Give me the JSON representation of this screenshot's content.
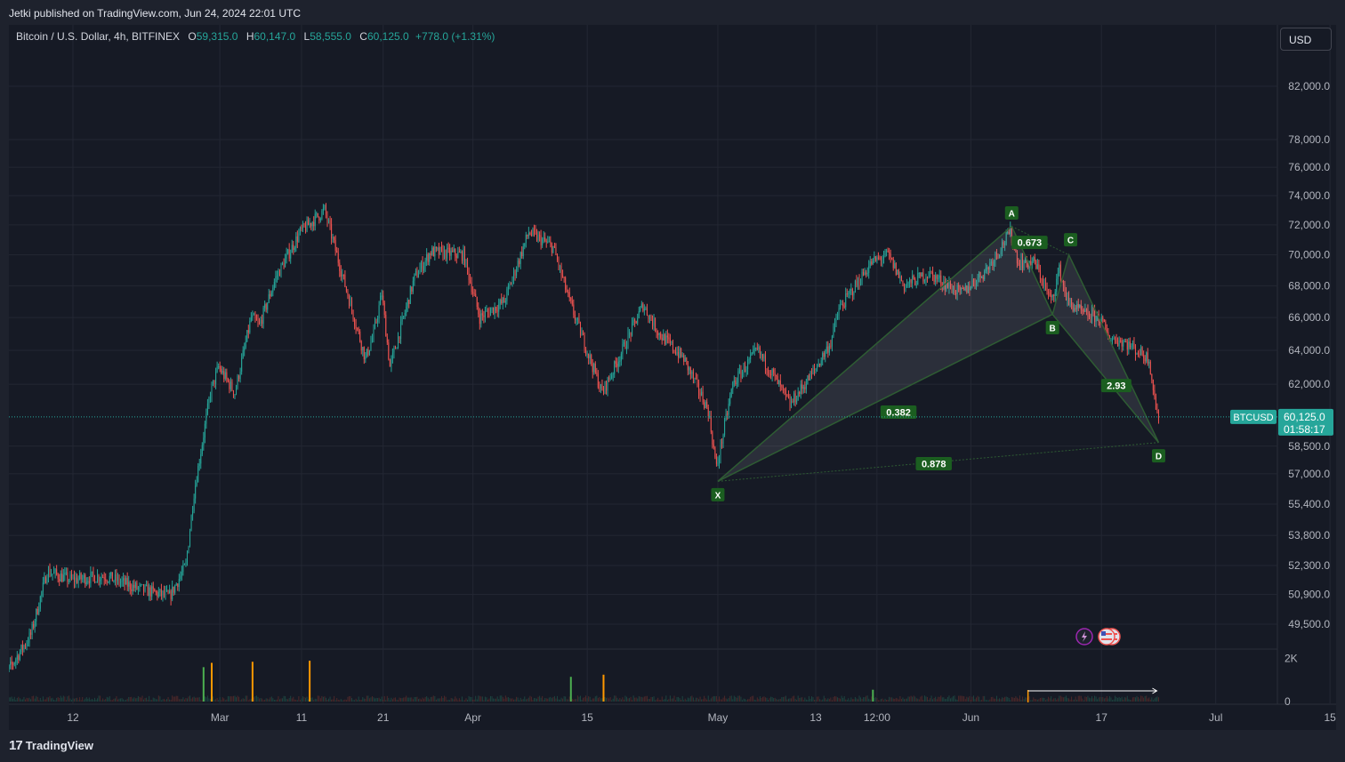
{
  "header": {
    "published": "Jetki published on TradingView.com, Jun 24, 2024 22:01 UTC"
  },
  "legend": {
    "symbol": "Bitcoin / U.S. Dollar, 4h, BITFINEX",
    "open_label": "O",
    "open": "59,315.0",
    "high_label": "H",
    "high": "60,147.0",
    "low_label": "L",
    "low": "58,555.0",
    "close_label": "C",
    "close": "60,125.0",
    "change": "+778.0 (+1.31%)"
  },
  "currency_button": "USD",
  "footer": {
    "logo_mark": "17",
    "logo_text": "TradingView"
  },
  "colors": {
    "up": "#26a69a",
    "down": "#ef5350",
    "pattern_line": "#2e5c33",
    "pattern_fill": "#b0b4bd",
    "label_bg": "#1b5e20",
    "price_tag": "#26a69a",
    "volume_up": "#4caf50",
    "volume_spike": "#ff9800"
  },
  "chart_data": {
    "type": "candlestick",
    "title": "Bitcoin / U.S. Dollar, 4h, BITFINEX",
    "y_scale": "log",
    "y_ticks": [
      "82,000.0",
      "78,000.0",
      "76,000.0",
      "74,000.0",
      "72,000.0",
      "70,000.0",
      "68,000.0",
      "66,000.0",
      "64,000.0",
      "62,000.0",
      "58,500.0",
      "57,000.0",
      "55,400.0",
      "53,800.0",
      "52,300.0",
      "50,900.0",
      "49,500.0"
    ],
    "x_ticks": [
      "12",
      "Mar",
      "11",
      "21",
      "Apr",
      "15",
      "May",
      "13",
      "12:00",
      "Jun",
      "17",
      "Jul",
      "15"
    ],
    "last_price": {
      "symbol": "BTCUSD",
      "value": "60,125.0",
      "countdown": "01:58:17",
      "price": 60125
    },
    "volume_ticks": [
      "2K",
      "0"
    ],
    "price_path": [
      {
        "x": "2024-02-03",
        "y": 46700
      },
      {
        "x": "2024-02-07",
        "y": 49000
      },
      {
        "x": "2024-02-09",
        "y": 52000
      },
      {
        "x": "2024-02-12",
        "y": 51600
      },
      {
        "x": "2024-02-16",
        "y": 51800
      },
      {
        "x": "2024-02-20",
        "y": 51200
      },
      {
        "x": "2024-02-24",
        "y": 50800
      },
      {
        "x": "2024-02-26",
        "y": 52300
      },
      {
        "x": "2024-02-27",
        "y": 56000
      },
      {
        "x": "2024-02-29",
        "y": 61500
      },
      {
        "x": "2024-03-01",
        "y": 63000
      },
      {
        "x": "2024-03-03",
        "y": 61500
      },
      {
        "x": "2024-03-05",
        "y": 66000
      },
      {
        "x": "2024-03-06",
        "y": 65500
      },
      {
        "x": "2024-03-08",
        "y": 68500
      },
      {
        "x": "2024-03-11",
        "y": 71500
      },
      {
        "x": "2024-03-14",
        "y": 73000
      },
      {
        "x": "2024-03-16",
        "y": 69000
      },
      {
        "x": "2024-03-19",
        "y": 63500
      },
      {
        "x": "2024-03-20",
        "y": 65000
      },
      {
        "x": "2024-03-21",
        "y": 67500
      },
      {
        "x": "2024-03-22",
        "y": 63000
      },
      {
        "x": "2024-03-25",
        "y": 68500
      },
      {
        "x": "2024-03-27",
        "y": 70200
      },
      {
        "x": "2024-03-31",
        "y": 70000
      },
      {
        "x": "2024-04-02",
        "y": 66000
      },
      {
        "x": "2024-04-05",
        "y": 67000
      },
      {
        "x": "2024-04-08",
        "y": 71500
      },
      {
        "x": "2024-04-11",
        "y": 70500
      },
      {
        "x": "2024-04-13",
        "y": 67000
      },
      {
        "x": "2024-04-17",
        "y": 61500
      },
      {
        "x": "2024-04-19",
        "y": 63500
      },
      {
        "x": "2024-04-22",
        "y": 66800
      },
      {
        "x": "2024-04-24",
        "y": 65000
      },
      {
        "x": "2024-04-27",
        "y": 63500
      },
      {
        "x": "2024-04-30",
        "y": 60500
      },
      {
        "x": "2024-05-01",
        "y": 57300
      },
      {
        "x": "2024-05-03",
        "y": 62000
      },
      {
        "x": "2024-05-06",
        "y": 64000
      },
      {
        "x": "2024-05-08",
        "y": 62500
      },
      {
        "x": "2024-05-10",
        "y": 60800
      },
      {
        "x": "2024-05-13",
        "y": 62800
      },
      {
        "x": "2024-05-15",
        "y": 64500
      },
      {
        "x": "2024-05-16",
        "y": 66500
      },
      {
        "x": "2024-05-20",
        "y": 69500
      },
      {
        "x": "2024-05-22",
        "y": 70000
      },
      {
        "x": "2024-05-24",
        "y": 68000
      },
      {
        "x": "2024-05-27",
        "y": 68800
      },
      {
        "x": "2024-05-31",
        "y": 67500
      },
      {
        "x": "2024-06-03",
        "y": 69000
      },
      {
        "x": "2024-06-06",
        "y": 71500
      },
      {
        "x": "2024-06-07",
        "y": 69500
      },
      {
        "x": "2024-06-09",
        "y": 69500
      },
      {
        "x": "2024-06-11",
        "y": 67000
      },
      {
        "x": "2024-06-12",
        "y": 69000
      },
      {
        "x": "2024-06-13",
        "y": 67000
      },
      {
        "x": "2024-06-15",
        "y": 66200
      },
      {
        "x": "2024-06-17",
        "y": 66000
      },
      {
        "x": "2024-06-18",
        "y": 64800
      },
      {
        "x": "2024-06-20",
        "y": 64500
      },
      {
        "x": "2024-06-23",
        "y": 63500
      },
      {
        "x": "2024-06-24",
        "y": 60125
      }
    ],
    "harmonic_pattern": {
      "points": [
        {
          "label": "X",
          "x": "2024-05-01",
          "y": 56600
        },
        {
          "label": "A",
          "x": "2024-06-06",
          "y": 71900
        },
        {
          "label": "B",
          "x": "2024-06-11",
          "y": 66200
        },
        {
          "label": "C",
          "x": "2024-06-13",
          "y": 70000
        },
        {
          "label": "D",
          "x": "2024-06-24",
          "y": 58700
        }
      ],
      "ratios": [
        {
          "label": "0.382"
        },
        {
          "label": "0.673"
        },
        {
          "label": "2.93"
        },
        {
          "label": "0.878"
        }
      ]
    },
    "volume_spikes": [
      {
        "x": "2024-02-28",
        "value": 1600,
        "color": "green"
      },
      {
        "x": "2024-02-29",
        "value": 1800,
        "color": "orange"
      },
      {
        "x": "2024-03-05",
        "value": 1850,
        "color": "orange"
      },
      {
        "x": "2024-03-12",
        "value": 1900,
        "color": "orange"
      },
      {
        "x": "2024-04-13",
        "value": 1150,
        "color": "green"
      },
      {
        "x": "2024-04-17",
        "value": 1250,
        "color": "orange"
      },
      {
        "x": "2024-05-20",
        "value": 550,
        "color": "green"
      }
    ],
    "grid": true
  }
}
